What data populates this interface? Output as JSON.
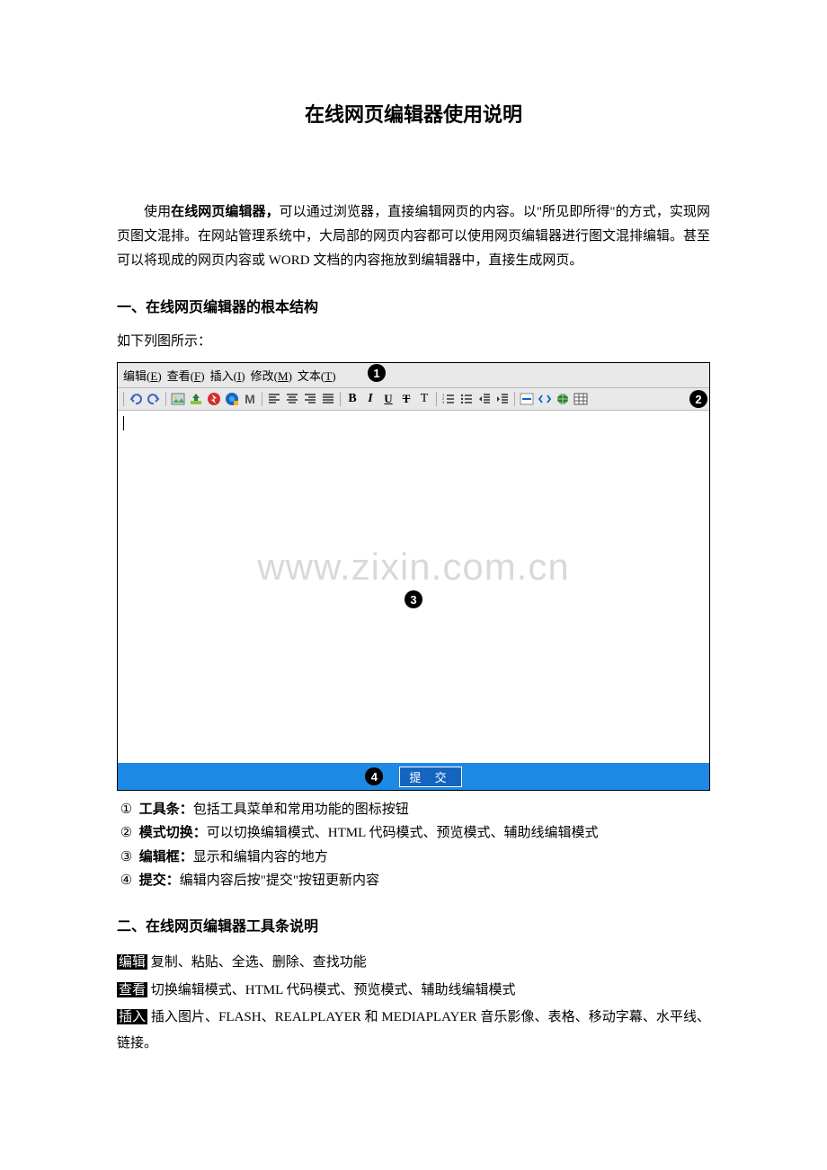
{
  "title": "在线网页编辑器使用说明",
  "intro_prefix": "使用",
  "intro_bold": "在线网页编辑器，",
  "intro_rest": "可以通过浏览器，直接编辑网页的内容。以\"所见即所得\"的方式，实现网页图文混排。在网站管理系统中，大局部的网页内容都可以使用网页编辑器进行图文混排编辑。甚至可以将现成的网页内容或 WORD 文档的内容拖放到编辑器中，直接生成网页。",
  "section1": "一、在线网页编辑器的根本结构",
  "fig_caption": "如下列图所示：",
  "menus": {
    "edit": {
      "label": "编辑",
      "hot": "E"
    },
    "view": {
      "label": "查看",
      "hot": "F"
    },
    "insert": {
      "label": "插入",
      "hot": "I"
    },
    "modify": {
      "label": "修改",
      "hot": "M"
    },
    "text": {
      "label": "文本",
      "hot": "T"
    }
  },
  "watermark": "www.zixin.com.cn",
  "submit_label": "提 交",
  "markers": {
    "m1": "1",
    "m2": "2",
    "m3": "3",
    "m4": "4"
  },
  "legend": [
    {
      "num": "①",
      "head": "工具条：",
      "body": "包括工具菜单和常用功能的图标按钮"
    },
    {
      "num": "②",
      "head": "模式切换：",
      "body": "可以切换编辑模式、HTML 代码模式、预览模式、辅助线编辑模式"
    },
    {
      "num": "③",
      "head": "编辑框：",
      "body": "显示和编辑内容的地方"
    },
    {
      "num": "④",
      "head": "提交：",
      "body": "编辑内容后按\"提交\"按钮更新内容"
    }
  ],
  "section2": "二、在线网页编辑器工具条说明",
  "tooldesc": [
    {
      "term": "编辑",
      "body": " 复制、粘贴、全选、删除、查找功能"
    },
    {
      "term": "查看",
      "body": " 切换编辑模式、HTML 代码模式、预览模式、辅助线编辑模式"
    },
    {
      "term": "插入",
      "body": " 插入图片、FLASH、REALPLAYER 和 MEDIAPLAYER 音乐影像、表格、移动字幕、水平线、链接。"
    }
  ]
}
